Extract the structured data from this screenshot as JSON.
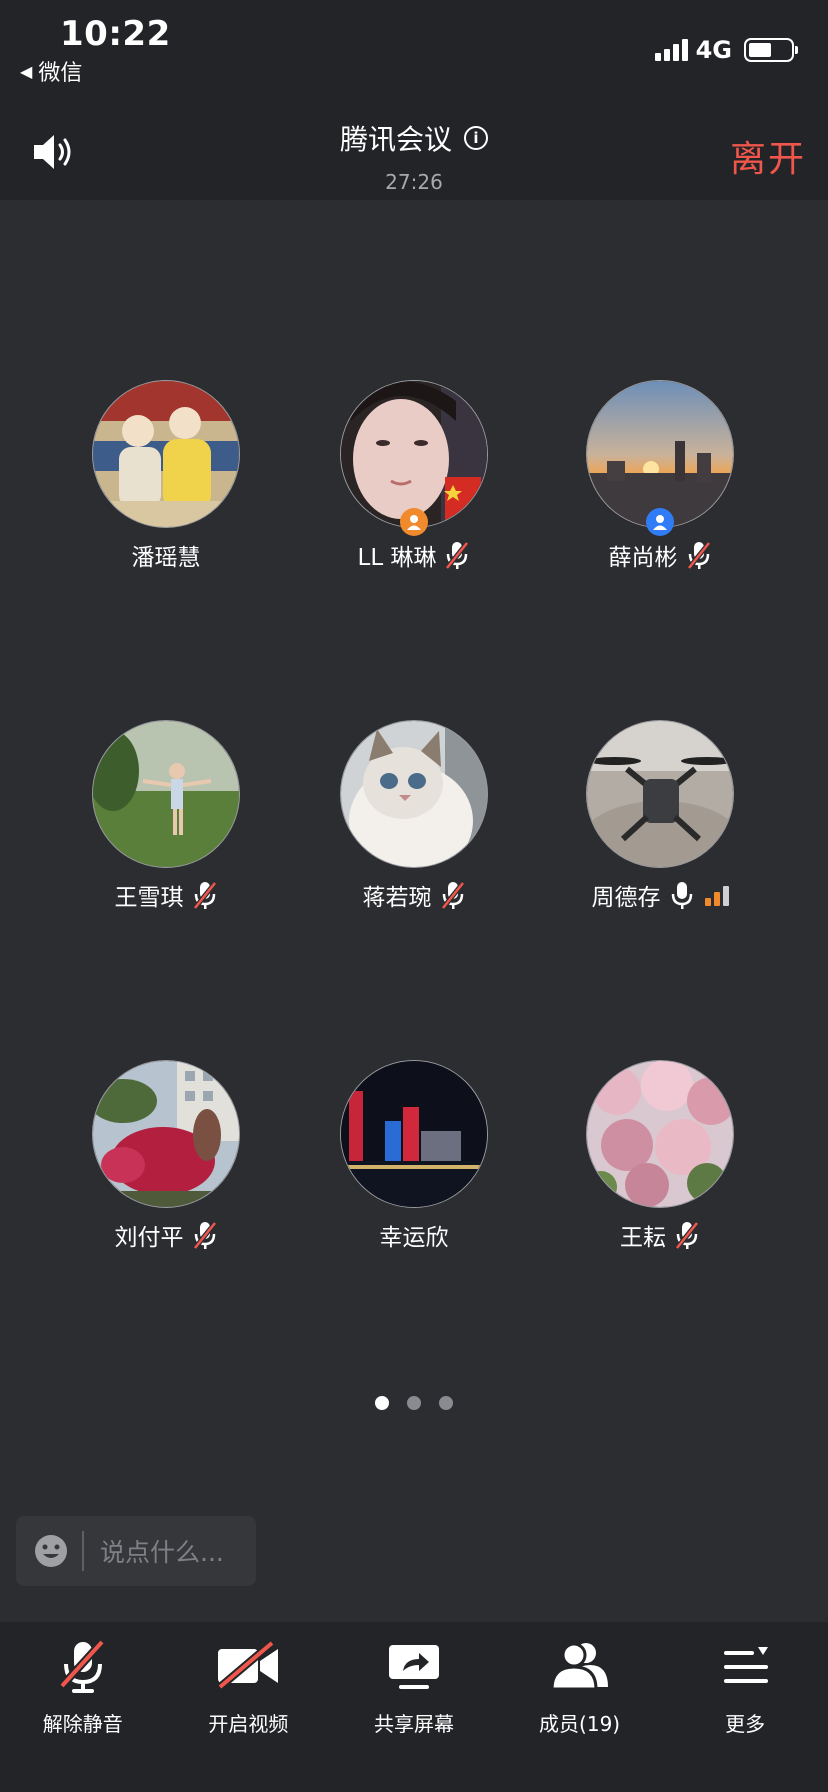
{
  "status_bar": {
    "time": "10:22",
    "back_app": "微信",
    "network": "4G",
    "battery_level": 0.55
  },
  "header": {
    "title": "腾讯会议",
    "timer": "27:26",
    "leave_label": "离开"
  },
  "participants": [
    {
      "name": "潘瑶慧",
      "mic": "none",
      "badge": "none",
      "avatar": "opera-painting-avatar"
    },
    {
      "name": "LL 琳琳",
      "mic": "muted",
      "badge": "host-orange",
      "avatar": "selfie-avatar"
    },
    {
      "name": "薛尚彬",
      "mic": "muted",
      "badge": "cohost-blue",
      "avatar": "sunset-city-avatar"
    },
    {
      "name": "王雪琪",
      "mic": "muted",
      "badge": "none",
      "avatar": "park-girl-avatar"
    },
    {
      "name": "蒋若琬",
      "mic": "muted",
      "badge": "none",
      "avatar": "cat-avatar"
    },
    {
      "name": "周德存",
      "mic": "on",
      "badge": "none",
      "avatar": "drone-avatar"
    },
    {
      "name": "刘付平",
      "mic": "muted",
      "badge": "none",
      "avatar": "garden-blossom-avatar"
    },
    {
      "name": "幸运欣",
      "mic": "none",
      "badge": "none",
      "avatar": "night-city-avatar"
    },
    {
      "name": "王耘",
      "mic": "muted",
      "badge": "none",
      "avatar": "cherry-blossom-avatar"
    }
  ],
  "pager": {
    "pages": 3,
    "current": 1
  },
  "chat": {
    "placeholder": "说点什么..."
  },
  "toolbar": {
    "unmute_label": "解除静音",
    "video_label": "开启视频",
    "share_label": "共享屏幕",
    "members_label": "成员(19)",
    "more_label": "更多"
  },
  "colors": {
    "leave": "#f0564b",
    "muted_slash": "#f0564b",
    "host_badge": "#f08a2c",
    "cohost_badge": "#2f7cf6",
    "volume_active": "#f08a2c"
  }
}
